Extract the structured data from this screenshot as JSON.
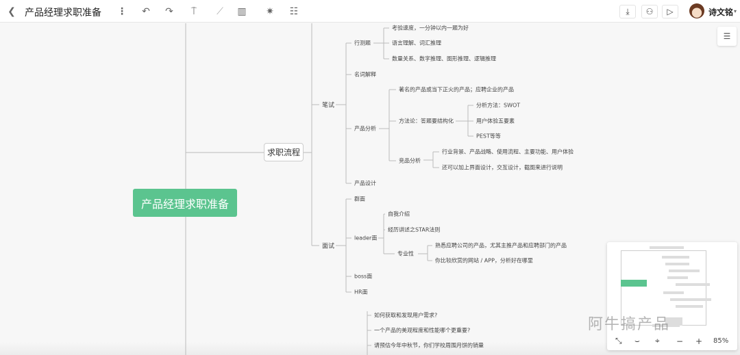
{
  "header": {
    "title": "产品经理求职准备",
    "user": "诗文铭"
  },
  "mindmap": {
    "root": "产品经理求职准备",
    "level1": "求职流程",
    "bishi": {
      "label": "笔试",
      "xingce": {
        "label": "行测题",
        "items": [
          "考验速度，一分钟以内一题为好",
          "语言理解、词汇推理",
          "数量关系、数字推理、图形推理、逻辑推理"
        ]
      },
      "mingci": "名词解释",
      "fenxi": {
        "label": "产品分析",
        "famous": "著名的产品或当下正火的产品；应聘企业的产品",
        "method": {
          "label": "方法论：答题要结构化",
          "items": [
            "分析方法：SWOT",
            "用户体验五要素",
            "PEST等等"
          ]
        },
        "jingpin": {
          "label": "竞品分析",
          "items": [
            "行业背景、产品战略、使用流程、主要功能、用户体验",
            "还可以加上界面设计，交互设计，截图来进行说明"
          ]
        }
      },
      "sheji": "产品设计"
    },
    "mianshi": {
      "label": "面试",
      "qunmian": "群面",
      "leader": {
        "label": "leader面",
        "items": [
          "自我介绍",
          "经历讲述之STAR法则"
        ],
        "zhuanye": {
          "label": "专业性",
          "items": [
            "熟悉应聘公司的产品，尤其主推产品和应聘部门的产品",
            "你比较欣赏的网站 / APP，分析好在哪里"
          ]
        }
      },
      "boss": "boss面",
      "hr": "HR面"
    },
    "questions": [
      "如何获取和发现用户需求?",
      "一个产品的美观程度和性能哪个更重要?",
      "请预估今年中秋节，你们学校周围月饼的销量"
    ]
  },
  "minimap": {
    "zoom": "85%"
  },
  "watermark": "阿牛搞产品",
  "colors": {
    "root": "#5bc48f"
  }
}
